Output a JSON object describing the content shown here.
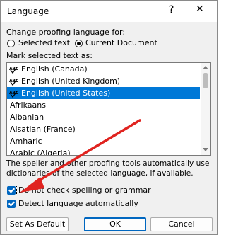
{
  "window": {
    "title": "Language",
    "help_glyph": "?",
    "close_glyph": "✕"
  },
  "proofing": {
    "label": "Change proofing language for:",
    "options": [
      "Selected text",
      "Current Document"
    ],
    "selected_index": 1
  },
  "list": {
    "label": "Mark selected text as:",
    "abc_glyph": "ABC",
    "items": [
      {
        "label": "English (Canada)",
        "proofing_icon": true,
        "selected": false
      },
      {
        "label": "English (United Kingdom)",
        "proofing_icon": true,
        "selected": false
      },
      {
        "label": "English (United States)",
        "proofing_icon": true,
        "selected": true
      },
      {
        "label": "Afrikaans",
        "proofing_icon": false,
        "selected": false
      },
      {
        "label": "Albanian",
        "proofing_icon": false,
        "selected": false
      },
      {
        "label": "Alsatian (France)",
        "proofing_icon": false,
        "selected": false
      },
      {
        "label": "Amharic",
        "proofing_icon": false,
        "selected": false
      },
      {
        "label": "Arabic (Algeria)",
        "proofing_icon": false,
        "selected": false
      }
    ]
  },
  "info_text": "The speller and other proofing tools automatically use dictionaries of the selected language, if available.",
  "checkboxes": [
    {
      "label": "Do not check spelling or grammar",
      "checked": true
    },
    {
      "label": "Detect language automatically",
      "checked": true
    }
  ],
  "buttons": {
    "set_default": "Set As Default",
    "ok": "OK",
    "cancel": "Cancel"
  },
  "colors": {
    "selection": "#0078d7",
    "checkbox": "#0067c0",
    "annotation_arrow": "#e0231f"
  }
}
